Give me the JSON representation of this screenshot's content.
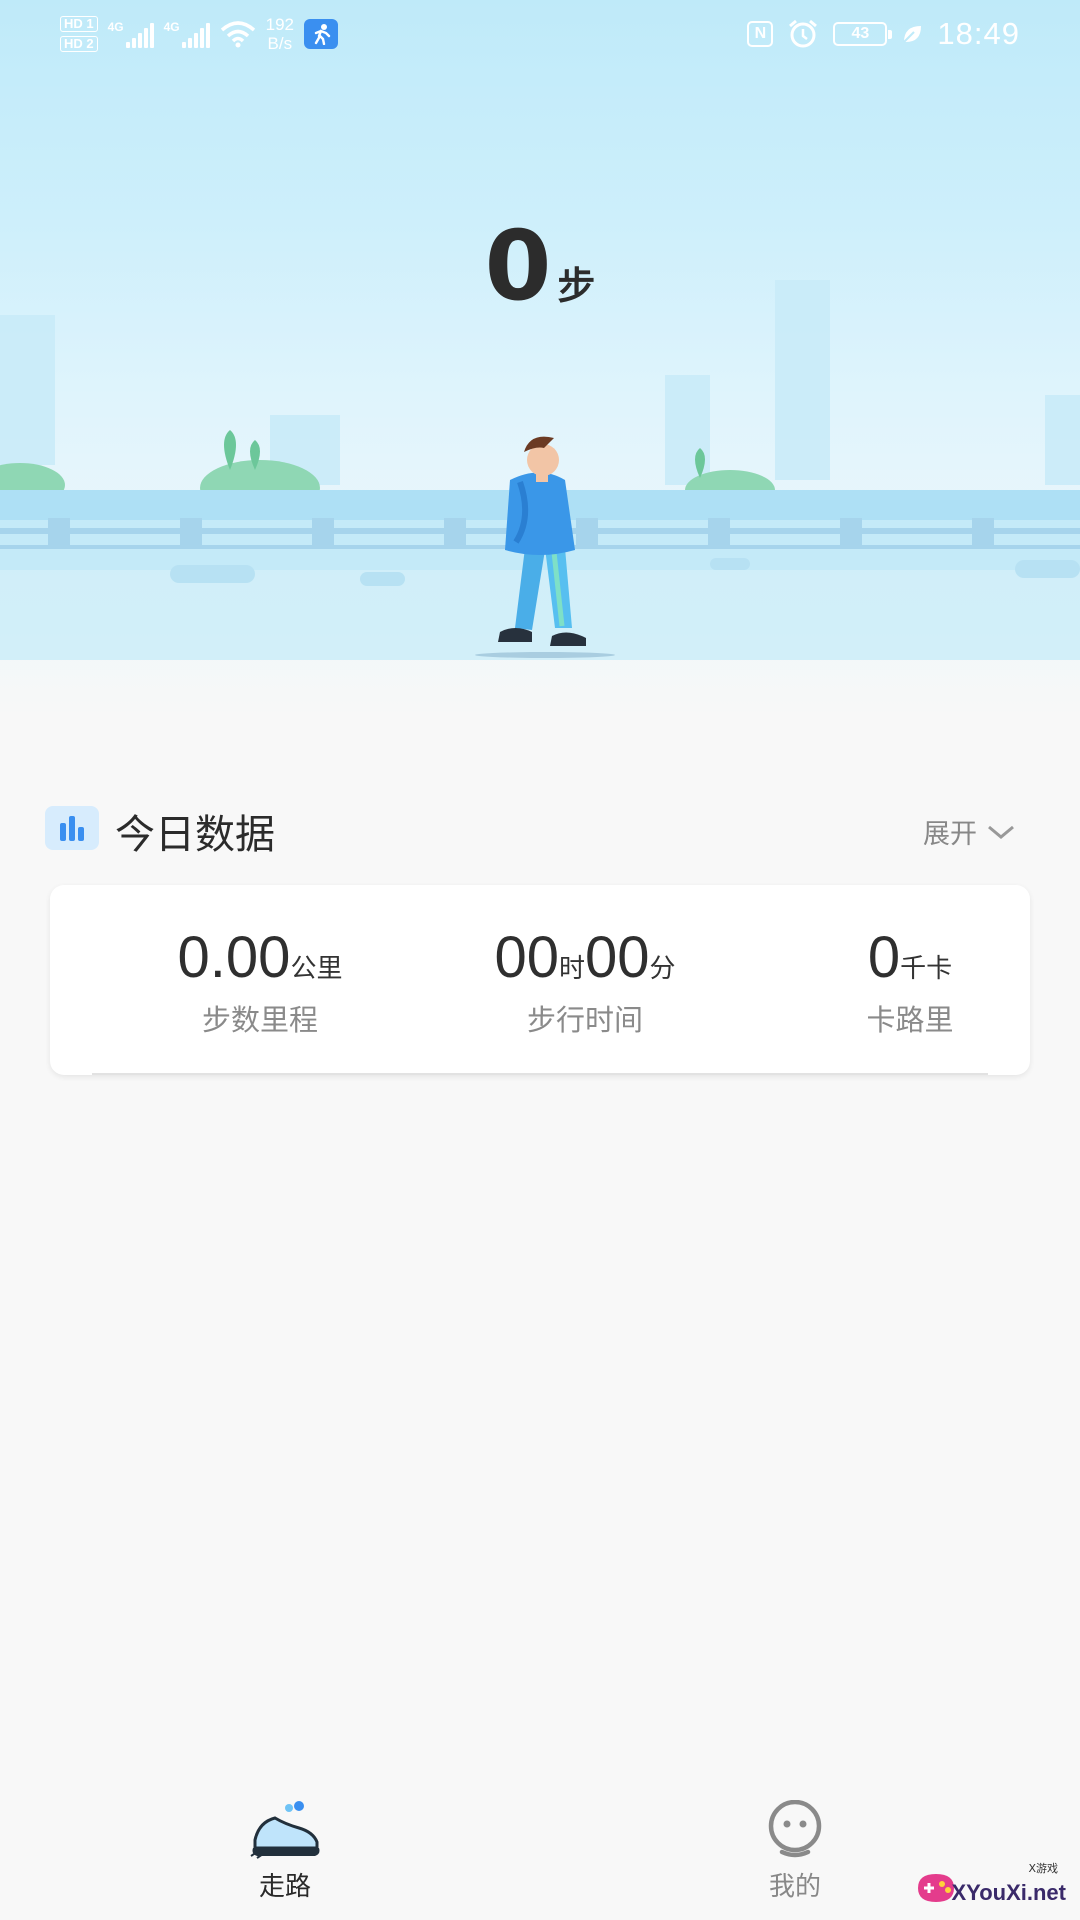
{
  "status_bar": {
    "sim1": "HD 1",
    "sim2": "HD 2",
    "net1": "4G",
    "net2": "4G",
    "speed_value": "192",
    "speed_unit": "B/s",
    "nfc": "N",
    "battery": "43",
    "time": "18:49",
    "icons": [
      "signal-icon",
      "wifi-icon",
      "running-app-icon",
      "nfc-icon",
      "alarm-icon",
      "battery-icon",
      "leaf-icon"
    ]
  },
  "hero": {
    "steps": "0",
    "steps_unit": "步"
  },
  "today": {
    "title": "今日数据",
    "expand_label": "展开",
    "stats": [
      {
        "value": "0.00",
        "unit": "公里",
        "label": "步数里程"
      },
      {
        "hours": "00",
        "hours_unit": "时",
        "minutes": "00",
        "minutes_unit": "分",
        "label": "步行时间"
      },
      {
        "value": "0",
        "unit": "千卡",
        "label": "卡路里"
      }
    ]
  },
  "tabbar": {
    "tabs": [
      {
        "label": "走路",
        "icon": "sneaker-icon",
        "active": true
      },
      {
        "label": "我的",
        "icon": "profile-face-icon",
        "active": false
      }
    ]
  },
  "watermark": {
    "text": "XYouXi.net",
    "small": "X游戏"
  },
  "colors": {
    "accent": "#3a8ff0",
    "sky_top": "#bfeaf9",
    "text_dark": "#2c2c2c",
    "text_muted": "#8a8a8a"
  }
}
